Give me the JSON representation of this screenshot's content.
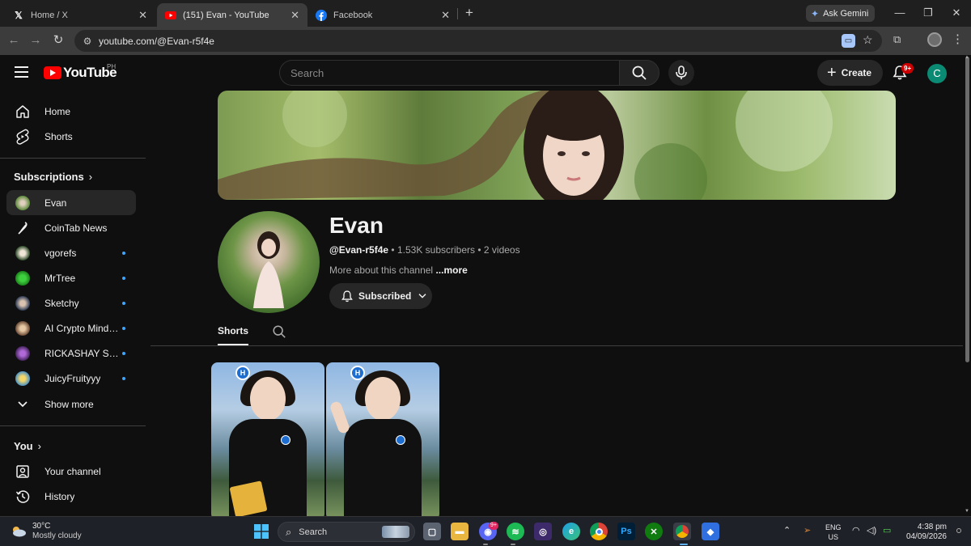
{
  "browser": {
    "tabs": [
      {
        "title": "Home / X",
        "icon": "x-icon"
      },
      {
        "title": "(151) Evan - YouTube",
        "icon": "youtube-icon"
      },
      {
        "title": "Facebook",
        "icon": "facebook-icon"
      }
    ],
    "active_tab": 1,
    "ask_gemini": "Ask Gemini",
    "url": "youtube.com/@Evan-r5f4e"
  },
  "youtube": {
    "logo_text": "YouTube",
    "country_code": "PH",
    "search_placeholder": "Search",
    "create_label": "Create",
    "notification_badge": "9+",
    "account_initial": "C",
    "accent_color": "#ff0000"
  },
  "sidebar": {
    "main": [
      {
        "label": "Home",
        "icon": "home-icon"
      },
      {
        "label": "Shorts",
        "icon": "shorts-icon"
      }
    ],
    "subscriptions_heading": "Subscriptions",
    "subscriptions": [
      {
        "label": "Evan",
        "active": true,
        "new": false
      },
      {
        "label": "CoinTab News",
        "active": false,
        "new": false
      },
      {
        "label": "vgorefs",
        "active": false,
        "new": true
      },
      {
        "label": "MrTree",
        "active": false,
        "new": true
      },
      {
        "label": "Sketchy",
        "active": false,
        "new": true
      },
      {
        "label": "AI Crypto Minds ...",
        "active": false,
        "new": true
      },
      {
        "label": "RICKASHAY SLO...",
        "active": false,
        "new": true
      },
      {
        "label": "JuicyFruityyy",
        "active": false,
        "new": true
      }
    ],
    "show_more": "Show more",
    "you_heading": "You",
    "you": [
      {
        "label": "Your channel",
        "icon": "user-box-icon"
      },
      {
        "label": "History",
        "icon": "history-icon"
      }
    ]
  },
  "channel": {
    "name": "Evan",
    "handle": "@Evan-r5f4e",
    "subscribers": "1.53K subscribers",
    "videos": "2 videos",
    "description": "More about this channel",
    "more_link": "...more",
    "subscribe_state": "Subscribed",
    "tabs": [
      {
        "label": "Shorts",
        "selected": true
      }
    ]
  },
  "taskbar": {
    "weather_temp": "30°C",
    "weather_condition": "Mostly cloudy",
    "search_label": "Search",
    "discord_badge": "9+",
    "language_line1": "ENG",
    "language_line2": "US",
    "time": "4:38 pm",
    "date": "04/09/2026"
  }
}
